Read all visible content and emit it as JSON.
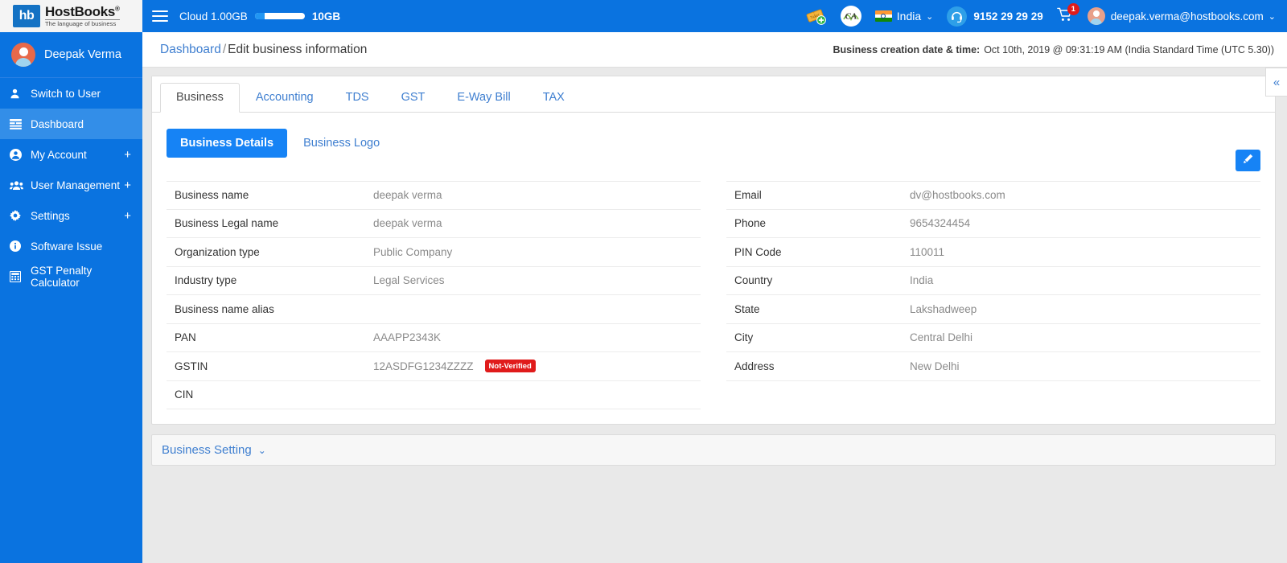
{
  "brand": {
    "logo_mark": "hb",
    "logo_title": "HostBooks",
    "logo_reg": "®",
    "logo_tagline": "The language of business",
    "accent_blue": "#0a73e0",
    "primary_blue": "#1683f5",
    "danger_red": "#e01b1b"
  },
  "sidebar": {
    "user_name": "Deepak Verma",
    "items": [
      {
        "label": "Switch to User",
        "icon": "user-icon",
        "active": false,
        "expandable": false
      },
      {
        "label": "Dashboard",
        "icon": "dashboard-icon",
        "active": true,
        "expandable": false
      },
      {
        "label": "My Account",
        "icon": "account-circle-icon",
        "active": false,
        "expandable": true
      },
      {
        "label": "User Management",
        "icon": "users-group-icon",
        "active": false,
        "expandable": true
      },
      {
        "label": "Settings",
        "icon": "gear-icon",
        "active": false,
        "expandable": true
      },
      {
        "label": "Software Issue",
        "icon": "info-icon",
        "active": false,
        "expandable": false
      },
      {
        "label": "GST Penalty Calculator",
        "icon": "calculator-icon",
        "active": false,
        "expandable": false
      }
    ],
    "expand_symbol": "+"
  },
  "topbar": {
    "menu_icon": "hamburger-icon",
    "cloud_label": "Cloud 1.00GB",
    "cloud_used_percent": 20,
    "cloud_max": "10GB",
    "ticket_icon": "add-ticket-icon",
    "ca_badge_text": "CA",
    "country": "India",
    "country_caret": "⌄",
    "flag_icon": "india-flag-icon",
    "support_icon": "headset-icon",
    "phone": "9152 29 29 29",
    "cart_icon": "shopping-cart-icon",
    "cart_badge": "1",
    "avatar_icon": "user-avatar-icon",
    "user_email": "deepak.verma@hostbooks.com",
    "user_caret": "⌄"
  },
  "breadcrumb": {
    "root": "Dashboard",
    "separator": "/",
    "current": "Edit business information",
    "creation_label": "Business creation date & time:",
    "creation_value": "Oct 10th, 2019 @ 09:31:19 AM (India Standard Time (UTC 5.30))"
  },
  "collapse_button": {
    "icon": "chevron-double-left-icon",
    "glyph": "«"
  },
  "tabs": [
    {
      "label": "Business",
      "active": true
    },
    {
      "label": "Accounting",
      "active": false
    },
    {
      "label": "TDS",
      "active": false
    },
    {
      "label": "GST",
      "active": false
    },
    {
      "label": "E-Way Bill",
      "active": false
    },
    {
      "label": "TAX",
      "active": false
    }
  ],
  "subtabs": {
    "primary": "Business Details",
    "secondary": "Business Logo"
  },
  "edit_button": {
    "icon": "pencil-icon"
  },
  "details": {
    "left": [
      {
        "label": "Business name",
        "value": "deepak verma"
      },
      {
        "label": "Business Legal name",
        "value": "deepak verma"
      },
      {
        "label": "Organization type",
        "value": "Public Company"
      },
      {
        "label": "Industry type",
        "value": "Legal Services"
      },
      {
        "label": "Business name alias",
        "value": ""
      },
      {
        "label": "PAN",
        "value": "AAAPP2343K"
      },
      {
        "label": "GSTIN",
        "value": "12ASDFG1234ZZZZ",
        "badge": "Not-Verified"
      },
      {
        "label": "CIN",
        "value": ""
      }
    ],
    "right": [
      {
        "label": "Email",
        "value": "dv@hostbooks.com"
      },
      {
        "label": "Phone",
        "value": "9654324454"
      },
      {
        "label": "PIN Code",
        "value": "110011"
      },
      {
        "label": "Country",
        "value": "India"
      },
      {
        "label": "State",
        "value": "Lakshadweep"
      },
      {
        "label": "City",
        "value": "Central Delhi"
      },
      {
        "label": "Address",
        "value": "New Delhi"
      }
    ]
  },
  "business_setting": {
    "label": "Business Setting",
    "caret": "⌄",
    "caret_icon": "chevron-down-icon"
  }
}
